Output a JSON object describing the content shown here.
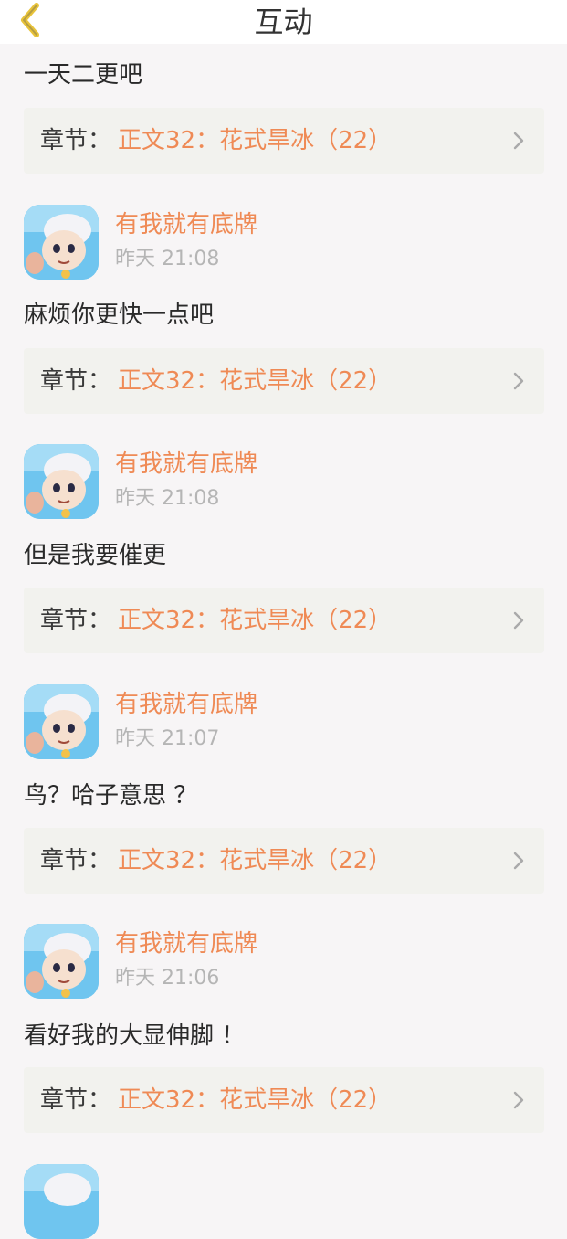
{
  "header": {
    "title": "互动"
  },
  "items": [
    {
      "comment": "一天二更吧",
      "chapter_prefix": "章节：",
      "chapter": "正文32：花式旱冰（22）"
    },
    {
      "user": "有我就有底牌",
      "time": "昨天 21:08",
      "comment": "麻烦你更快一点吧",
      "chapter_prefix": "章节：",
      "chapter": "正文32：花式旱冰（22）"
    },
    {
      "user": "有我就有底牌",
      "time": "昨天 21:08",
      "comment": "但是我要催更",
      "chapter_prefix": "章节：",
      "chapter": "正文32：花式旱冰（22）"
    },
    {
      "user": "有我就有底牌",
      "time": "昨天 21:07",
      "comment": "鸟？哈子意思 ？",
      "chapter_prefix": "章节：",
      "chapter": "正文32：花式旱冰（22）"
    },
    {
      "user": "有我就有底牌",
      "time": "昨天 21:06",
      "comment": "看好我的大显伸脚 ！",
      "chapter_prefix": "章节：",
      "chapter": "正文32：花式旱冰（22）"
    }
  ],
  "colors": {
    "accent": "#ef8a55",
    "back_icon": "#e8c33a",
    "page_bg": "#f7f5f6",
    "chapter_bg": "#f2f2ee"
  },
  "icons": {
    "back": "chevron-left-icon",
    "chapter_arrow": "chevron-right-icon"
  }
}
